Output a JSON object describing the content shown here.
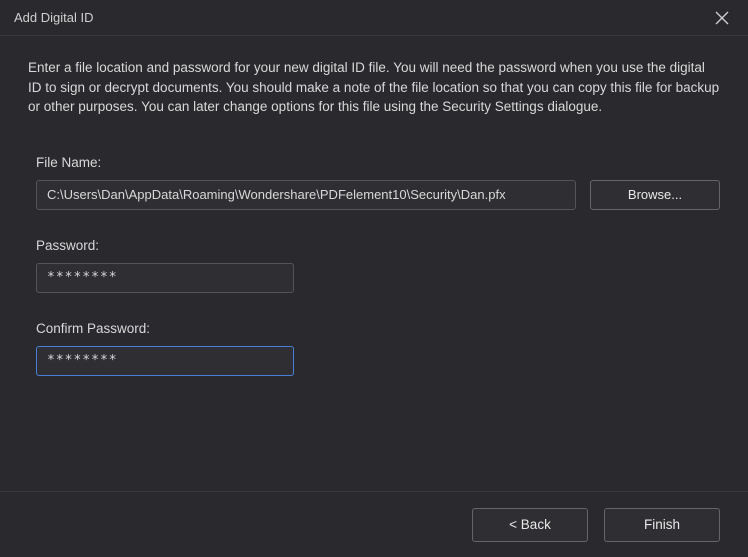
{
  "window": {
    "title": "Add Digital ID"
  },
  "description": "Enter a file location and password for your new digital ID file. You will need the password when you use the digital ID to sign or decrypt documents. You should make a note of the file location so that you can copy this file for backup or other purposes. You can later change options for this file using the Security Settings dialogue.",
  "fields": {
    "fileName": {
      "label": "File Name:",
      "value": "C:\\Users\\Dan\\AppData\\Roaming\\Wondershare\\PDFelement10\\Security\\Dan.pfx"
    },
    "browse": {
      "label": "Browse..."
    },
    "password": {
      "label": "Password:",
      "masked": "********"
    },
    "confirmPassword": {
      "label": "Confirm Password:",
      "masked": "********"
    }
  },
  "buttons": {
    "back": "< Back",
    "finish": "Finish"
  }
}
